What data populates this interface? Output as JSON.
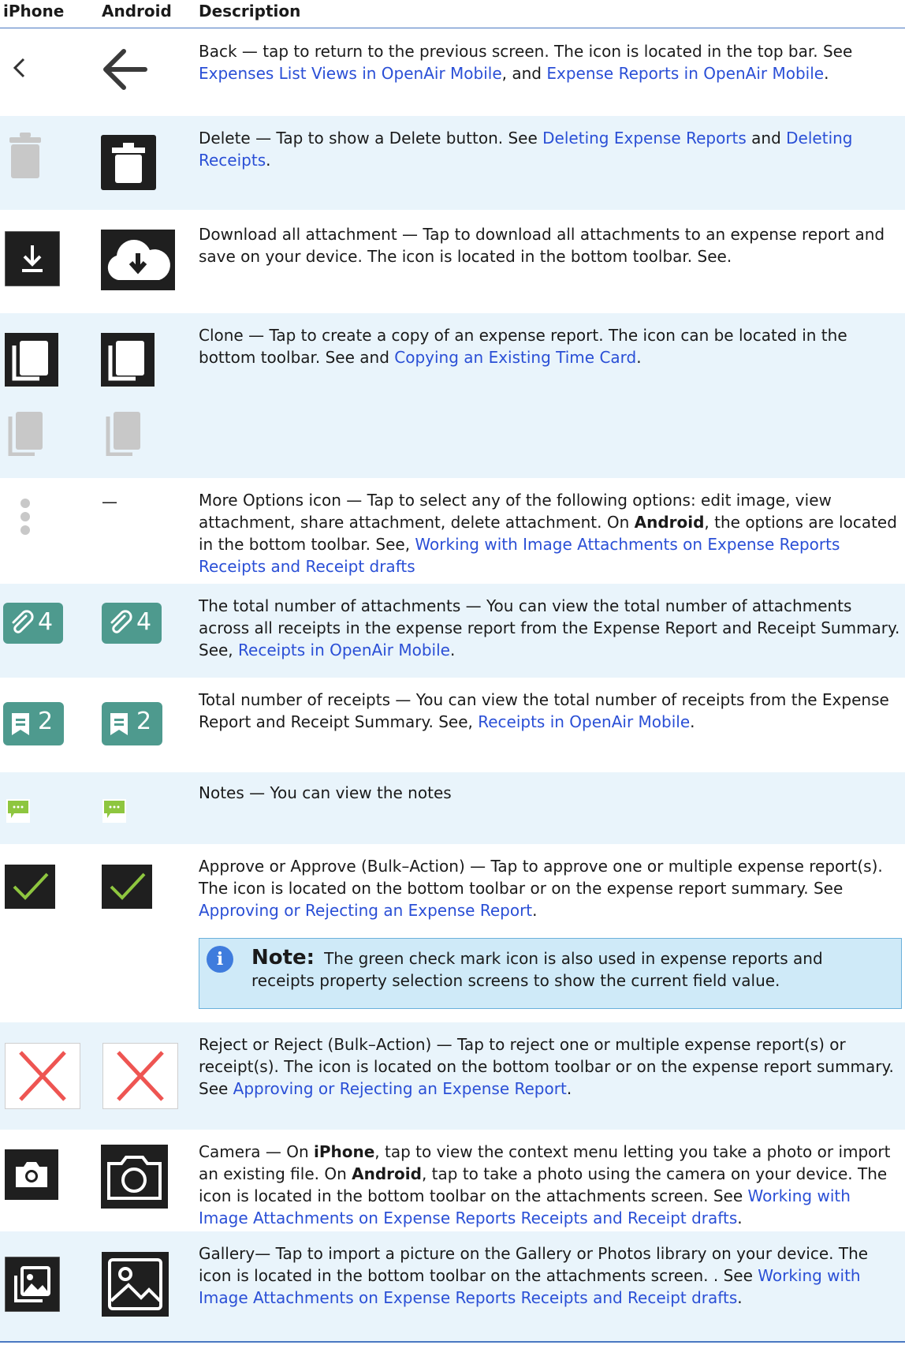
{
  "header": {
    "iphone": "iPhone",
    "android": "Android",
    "description": "Description"
  },
  "rows": [
    {
      "icon": "back-icon",
      "parts": [
        {
          "t": "Back — tap to return to the previous screen. The icon is located in the top bar. See "
        },
        {
          "t": "Expenses List Views in OpenAir Mobile",
          "link": true
        },
        {
          "t": ", and "
        },
        {
          "t": "Expense Reports in OpenAir Mobile",
          "link": true
        },
        {
          "t": "."
        }
      ]
    },
    {
      "icon": "trash-icon",
      "parts": [
        {
          "t": "Delete — Tap to show a Delete button. See "
        },
        {
          "t": "Deleting Expense Reports",
          "link": true
        },
        {
          "t": " and "
        },
        {
          "t": "Deleting Receipts",
          "link": true
        },
        {
          "t": "."
        }
      ]
    },
    {
      "icon": "download-icon",
      "parts": [
        {
          "t": "Download all attachment — Tap to download all attachments to an expense report and save on your device. The icon is located in the bottom toolbar. See."
        }
      ]
    },
    {
      "icon": "clone-icon",
      "parts": [
        {
          "t": "Clone — Tap to create a copy of an expense report. The icon can be located in the bottom toolbar. See and "
        },
        {
          "t": "Copying an Existing Time Card",
          "link": true
        },
        {
          "t": "."
        }
      ]
    },
    {
      "icon": "more-options-icon",
      "android_text": "—",
      "parts": [
        {
          "t": "More Options icon — Tap to select any of the following options: edit image, view attachment, share attachment, delete attachment. On "
        },
        {
          "t": "Android",
          "bold": true
        },
        {
          "t": ", the options are located in the bottom toolbar. See, "
        },
        {
          "t": "Working with Image Attachments on Expense Reports Receipts and Receipt drafts",
          "link": true
        }
      ]
    },
    {
      "icon": "attachment-count-badge",
      "parts": [
        {
          "t": "The total number of attachments — You can view the total number of attachments across all receipts in the expense report from the Expense Report and Receipt Summary. See, "
        },
        {
          "t": "Receipts in OpenAir Mobile",
          "link": true
        },
        {
          "t": "."
        }
      ]
    },
    {
      "icon": "receipt-count-badge",
      "parts": [
        {
          "t": "Total number of receipts — You can view the total number of receipts from the Expense Report and Receipt Summary. See, "
        },
        {
          "t": "Receipts in OpenAir Mobile",
          "link": true
        },
        {
          "t": "."
        }
      ]
    },
    {
      "icon": "notes-icon",
      "parts": [
        {
          "t": "Notes — You can view the notes"
        }
      ]
    },
    {
      "icon": "approve-icon",
      "parts": [
        {
          "t": "Approve or Approve (Bulk–Action) — Tap to approve one or multiple expense report(s). The icon is located on the bottom toolbar or on the expense report summary. See "
        },
        {
          "t": "Approving or Rejecting an Expense Report",
          "link": true
        },
        {
          "t": "."
        }
      ]
    },
    {
      "icon": "reject-icon",
      "parts": [
        {
          "t": "Reject or Reject (Bulk–Action) — Tap to reject one or multiple expense report(s) or receipt(s). The icon is located on the bottom toolbar or on the expense report summary. See "
        },
        {
          "t": "Approving or Rejecting an Expense Report",
          "link": true
        },
        {
          "t": "."
        }
      ]
    },
    {
      "icon": "camera-icon",
      "parts": [
        {
          "t": "Camera — On "
        },
        {
          "t": "iPhone",
          "bold": true
        },
        {
          "t": ", tap to view the context menu letting you take a photo or import an existing file. On "
        },
        {
          "t": "Android",
          "bold": true
        },
        {
          "t": ", tap to take a photo using the camera on your device. The icon is located in the bottom toolbar on the attachments screen. See "
        },
        {
          "t": "Working with Image Attachments on Expense Reports Receipts and Receipt drafts",
          "link": true
        },
        {
          "t": "."
        }
      ]
    },
    {
      "icon": "gallery-icon",
      "parts": [
        {
          "t": "Gallery— Tap to import a picture on the Gallery or Photos library on your device. The icon is located in the bottom toolbar on the attachments screen. . See "
        },
        {
          "t": "Working with Image Attachments on Expense Reports Receipts and Receipt drafts",
          "link": true
        },
        {
          "t": "."
        }
      ]
    }
  ],
  "badges": {
    "attachments_count": "4",
    "receipts_count": "2"
  },
  "note": {
    "icon": "info-icon",
    "icon_glyph": "i",
    "title": "Note:",
    "text": "The green check mark icon is also used in expense reports and receipts property selection screens to show the current field value."
  },
  "colors": {
    "link": "#2a4fd6",
    "row_alt": "#e9f4fb",
    "badge": "#4e9a8e",
    "approve_check": "#8ec63f",
    "reject_x": "#ee5552",
    "note_bg": "#cfeaf8"
  }
}
